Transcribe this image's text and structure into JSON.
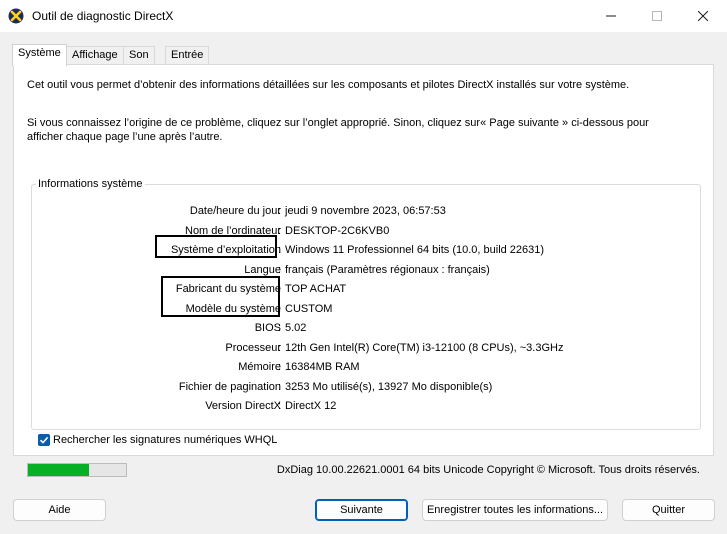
{
  "window": {
    "title": "Outil de diagnostic DirectX",
    "icon": "directx-app-icon"
  },
  "tabs": [
    {
      "label": "Système",
      "active": true
    },
    {
      "label": "Affichage",
      "active": false
    },
    {
      "label": "Son",
      "active": false
    },
    {
      "label": "Entrée",
      "active": false
    }
  ],
  "intro": {
    "line1": "Cet outil vous permet d’obtenir des informations détaillées sur les composants et pilotes DirectX installés sur votre système.",
    "line2": "Si vous connaissez l’origine de ce problème, cliquez sur l’onglet approprié. Sinon, cliquez sur« Page suivante » ci-dessous pour afficher chaque page l’une après l’autre."
  },
  "system_info": {
    "group_title": "Informations système",
    "rows": [
      {
        "label": "Date/heure du jour",
        "value": "jeudi 9 novembre 2023, 06:57:53"
      },
      {
        "label": "Nom de l’ordinateur",
        "value": "DESKTOP-2C6KVB0"
      },
      {
        "label": "Système d’exploitation",
        "value": "Windows 11 Professionnel 64 bits (10.0, build 22631)"
      },
      {
        "label": "Langue",
        "value": "français (Paramètres régionaux : français)"
      },
      {
        "label": "Fabricant du système",
        "value": "TOP ACHAT"
      },
      {
        "label": "Modèle du système",
        "value": "CUSTOM"
      },
      {
        "label": "BIOS",
        "value": "5.02"
      },
      {
        "label": "Processeur",
        "value": "12th Gen Intel(R) Core(TM) i3-12100 (8 CPUs), ~3.3GHz"
      },
      {
        "label": "Mémoire",
        "value": "16384MB RAM"
      },
      {
        "label": "Fichier de pagination",
        "value": "3253 Mo utilisé(s), 13927 Mo disponible(s)"
      },
      {
        "label": "Version DirectX",
        "value": "DirectX 12"
      }
    ],
    "colon": ":"
  },
  "whql_checkbox": {
    "label": "Rechercher les signatures numériques WHQL",
    "checked": true
  },
  "progress": {
    "fraction": 0.62,
    "color": "#06b025"
  },
  "footer_text": "DxDiag 10.00.22621.0001 64 bits Unicode Copyright © Microsoft. Tous droits réservés.",
  "buttons": {
    "help": "Aide",
    "next": "Suivante",
    "save_all": "Enregistrer toutes les informations...",
    "quit": "Quitter"
  }
}
